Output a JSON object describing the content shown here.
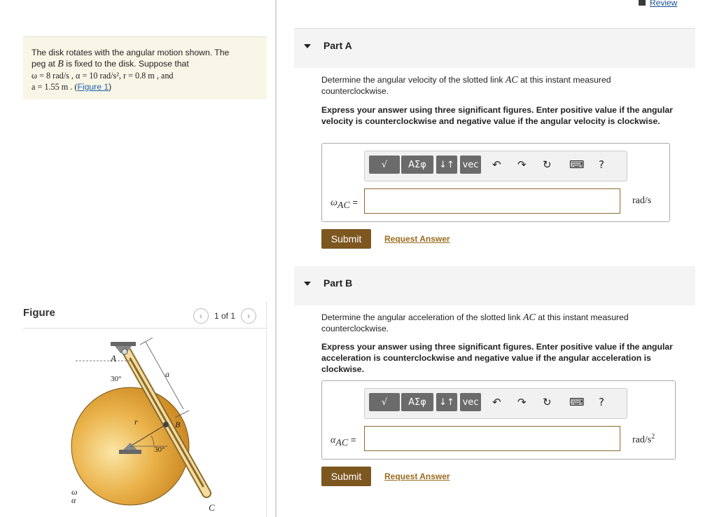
{
  "header": {
    "review_label": "Review"
  },
  "problem": {
    "line1": "The disk rotates with the angular motion shown. The",
    "line2_pre": "peg at ",
    "peg_var": "B",
    "line2_post": " is fixed to the disk. Suppose that",
    "line3": "ω = 8 rad/s , α = 10 rad/s², r = 0.8 m , and",
    "line4": "a = 1.55 m . (",
    "figure_link": "Figure 1",
    "line4_end": ")"
  },
  "figure": {
    "title": "Figure",
    "pager": "1 of 1",
    "labels": {
      "A": "A",
      "B": "B",
      "C": "C",
      "a": "a",
      "r": "r",
      "angle_top": "30°",
      "angle_bottom": "30°",
      "omega": "ω",
      "alpha": "α"
    }
  },
  "partA": {
    "title": "Part A",
    "question_pre": "Determine the angular velocity of the slotted link ",
    "question_var": "AC",
    "question_post": " at this instant measured counterclockwise.",
    "instruction": "Express your answer using three significant figures. Enter positive value if the angular velocity is counterclockwise and negative value if the angular velocity is clockwise.",
    "var_symbol": "ω",
    "var_sub": "AC",
    "var_eq": " =",
    "unit": "rad/s",
    "submit_label": "Submit",
    "request_label": "Request Answer"
  },
  "partB": {
    "title": "Part B",
    "question_pre": "Determine the angular acceleration of the slotted link ",
    "question_var": "AC",
    "question_post": " at this instant measured counterclockwise.",
    "instruction": "Express your answer using three significant figures. Enter positive value if the angular acceleration is counterclockwise and negative value if the angular acceleration is clockwise.",
    "var_symbol": "α",
    "var_sub": "AC",
    "var_eq": " =",
    "unit": "rad/s",
    "unit_sup": "2",
    "submit_label": "Submit",
    "request_label": "Request Answer"
  },
  "toolbar": {
    "templates_label": "√",
    "symbols_label": "ΑΣφ",
    "arrows_label": "↓↑",
    "vec_label": "vec",
    "undo_icon": "↶",
    "redo_icon": "↷",
    "reset_icon": "↻",
    "keyboard_icon": "⌨",
    "help_label": "?"
  },
  "colors": {
    "accent": "#7d5720",
    "link": "#1a5fb4",
    "request": "#9a6b1e",
    "problem_bg": "#f8f6e6"
  }
}
